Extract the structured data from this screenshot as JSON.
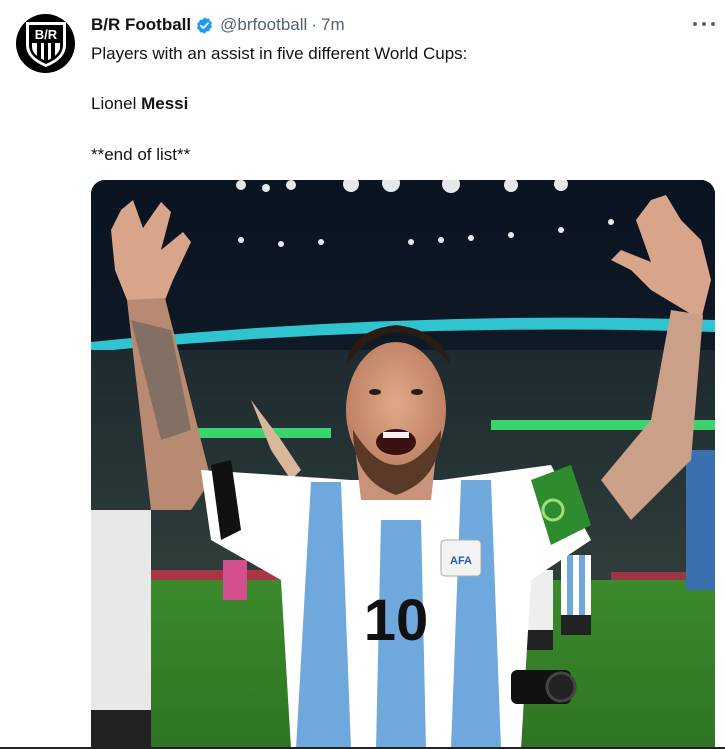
{
  "tweet": {
    "author_name": "B/R Football",
    "author_handle": "@brfootball",
    "separator": "·",
    "timestamp": "7m",
    "avatar_text": "B/R",
    "verified_icon": "verified-badge-icon",
    "more_icon": "more-options-icon",
    "text": {
      "line1": "Players with an assist in five different World Cups:",
      "line2_plain": "Lionel ",
      "line2_bold": "Messi",
      "line3": "**end of list**"
    },
    "media": {
      "jersey_number": "10",
      "badge_text": "AFA"
    }
  },
  "colors": {
    "verified": "#1d9bf0",
    "text_primary": "#0f1419",
    "text_secondary": "#536471",
    "jersey_blue": "#6fa8dc",
    "pitch": "#3f8a2c",
    "captain_band": "#2e8b2e"
  }
}
